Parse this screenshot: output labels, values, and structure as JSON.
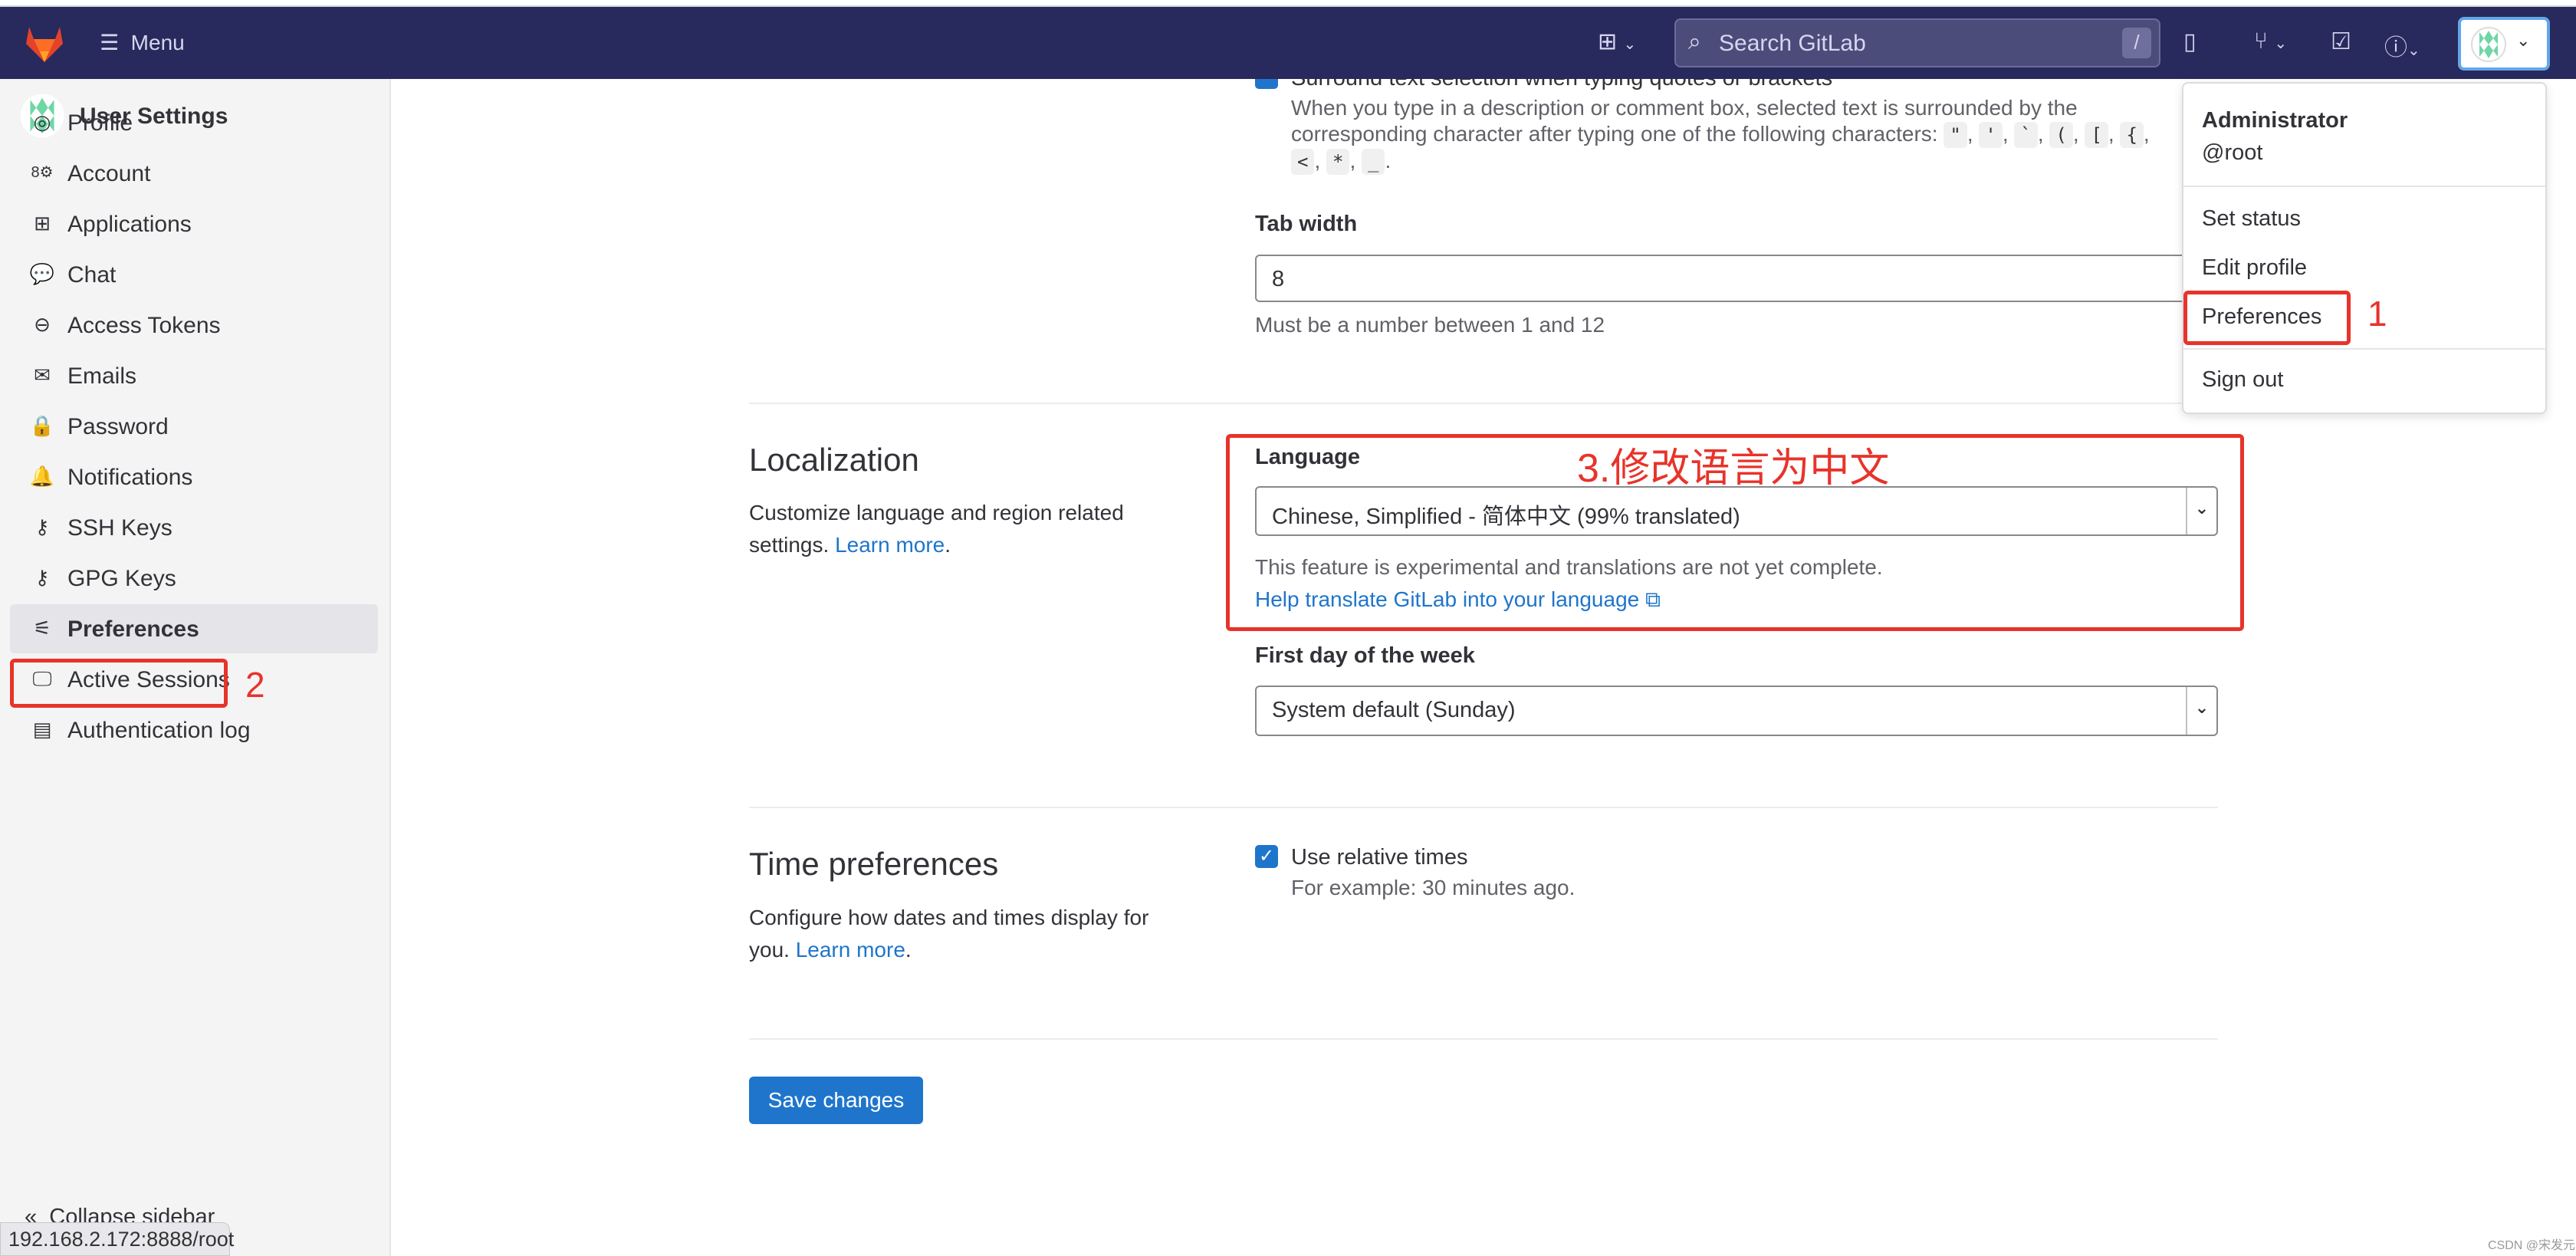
{
  "header": {
    "menu_label": "Menu",
    "search_placeholder": "Search GitLab",
    "search_shortcut": "/",
    "bg_color": "#28295c"
  },
  "sidebar": {
    "title": "User Settings",
    "items": [
      {
        "label": "Profile",
        "icon": "profile-icon"
      },
      {
        "label": "Account",
        "icon": "account-icon"
      },
      {
        "label": "Applications",
        "icon": "applications-icon"
      },
      {
        "label": "Chat",
        "icon": "chat-icon"
      },
      {
        "label": "Access Tokens",
        "icon": "token-icon"
      },
      {
        "label": "Emails",
        "icon": "mail-icon"
      },
      {
        "label": "Password",
        "icon": "lock-icon"
      },
      {
        "label": "Notifications",
        "icon": "bell-icon"
      },
      {
        "label": "SSH Keys",
        "icon": "key-icon"
      },
      {
        "label": "GPG Keys",
        "icon": "key-icon"
      },
      {
        "label": "Preferences",
        "icon": "preferences-icon",
        "active": true
      },
      {
        "label": "Active Sessions",
        "icon": "monitor-icon"
      },
      {
        "label": "Authentication log",
        "icon": "log-icon"
      }
    ],
    "collapse_label": "Collapse sidebar"
  },
  "editor": {
    "surround_label": "Surround text selection when typing quotes or brackets",
    "surround_desc": "When you type in a description or comment box, selected text is surrounded by the corresponding character after typing one of the following characters:",
    "surround_chars": [
      "\"",
      "'",
      "`",
      "(",
      "[",
      "{",
      "<",
      "*",
      "_"
    ],
    "tab_width_label": "Tab width",
    "tab_width_value": "8",
    "tab_width_help": "Must be a number between 1 and 12"
  },
  "localization": {
    "title": "Localization",
    "desc": "Customize language and region related settings.",
    "learn_more": "Learn more",
    "language_label": "Language",
    "language_value": "Chinese, Simplified - 简体中文 (99% translated)",
    "language_help": "This feature is experimental and translations are not yet complete.",
    "translate_link": "Help translate GitLab into your language",
    "first_day_label": "First day of the week",
    "first_day_value": "System default (Sunday)"
  },
  "time": {
    "title": "Time preferences",
    "desc": "Configure how dates and times display for you.",
    "learn_more": "Learn more",
    "relative_label": "Use relative times",
    "relative_checked": true,
    "relative_help": "For example: 30 minutes ago."
  },
  "save_label": "Save changes",
  "user_menu": {
    "name": "Administrator",
    "username": "@root",
    "items": [
      "Set status",
      "Edit profile",
      "Preferences",
      "Sign out"
    ]
  },
  "annotations": {
    "step1": "1",
    "step2": "2",
    "step3": "3.修改语言为中文",
    "color": "#e8332a"
  },
  "status_url": "192.168.2.172:8888/root",
  "watermark": "CSDN @宋发元"
}
